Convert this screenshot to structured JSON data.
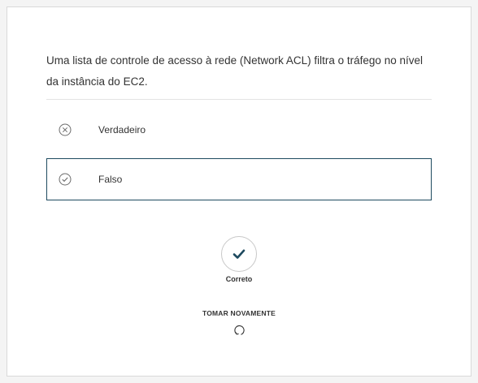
{
  "question": {
    "text": "Uma lista de controle de acesso à rede (Network ACL) filtra o tráfego no nível da instância do EC2."
  },
  "options": [
    {
      "label": "Verdadeiro",
      "icon": "x-circle-icon",
      "selected": false
    },
    {
      "label": "Falso",
      "icon": "check-circle-icon",
      "selected": true
    }
  ],
  "result": {
    "label": "Correto",
    "icon": "checkmark-icon"
  },
  "retake": {
    "label": "TOMAR NOVAMENTE",
    "icon": "refresh-icon"
  },
  "colors": {
    "accent": "#1e4a5f",
    "border": "#d9d9d9",
    "text": "#333333"
  }
}
